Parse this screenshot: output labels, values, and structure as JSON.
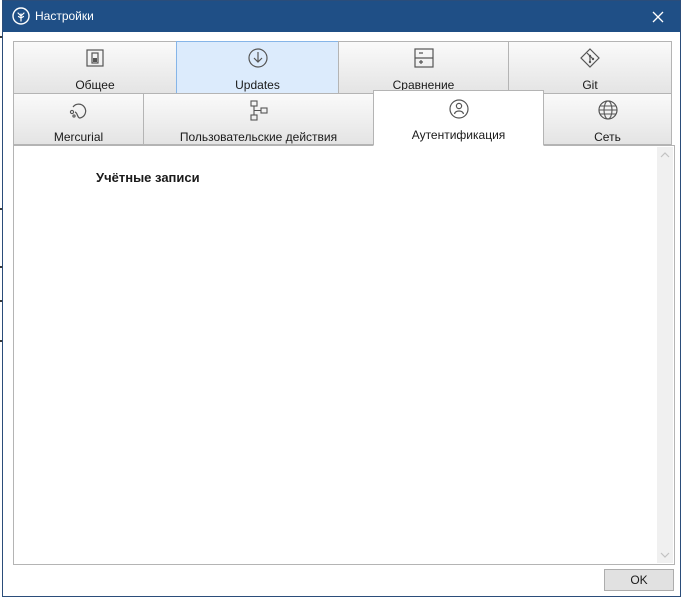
{
  "window": {
    "title": "Настройки"
  },
  "tabs_row1": [
    {
      "label": "Общее",
      "icon": "toggle-icon"
    },
    {
      "label": "Updates",
      "icon": "download-circle-icon"
    },
    {
      "label": "Сравнение",
      "icon": "compare-icon"
    },
    {
      "label": "Git",
      "icon": "git-icon"
    }
  ],
  "tabs_row2": [
    {
      "label": "Mercurial",
      "icon": "mercurial-icon"
    },
    {
      "label": "Пользовательские действия",
      "icon": "flowchart-icon"
    },
    {
      "label": "Аутентификация",
      "icon": "user-circle-icon"
    },
    {
      "label": "Сеть",
      "icon": "globe-icon"
    }
  ],
  "active_tab": "Аутентификация",
  "hovered_tab": "Updates",
  "content": {
    "heading": "Учётные записи"
  },
  "buttons": {
    "ok": "OK"
  },
  "colors": {
    "titlebar": "#1f4f86",
    "tab_hover": "#dcebfc",
    "tab_hover_border": "#86b5e8"
  }
}
